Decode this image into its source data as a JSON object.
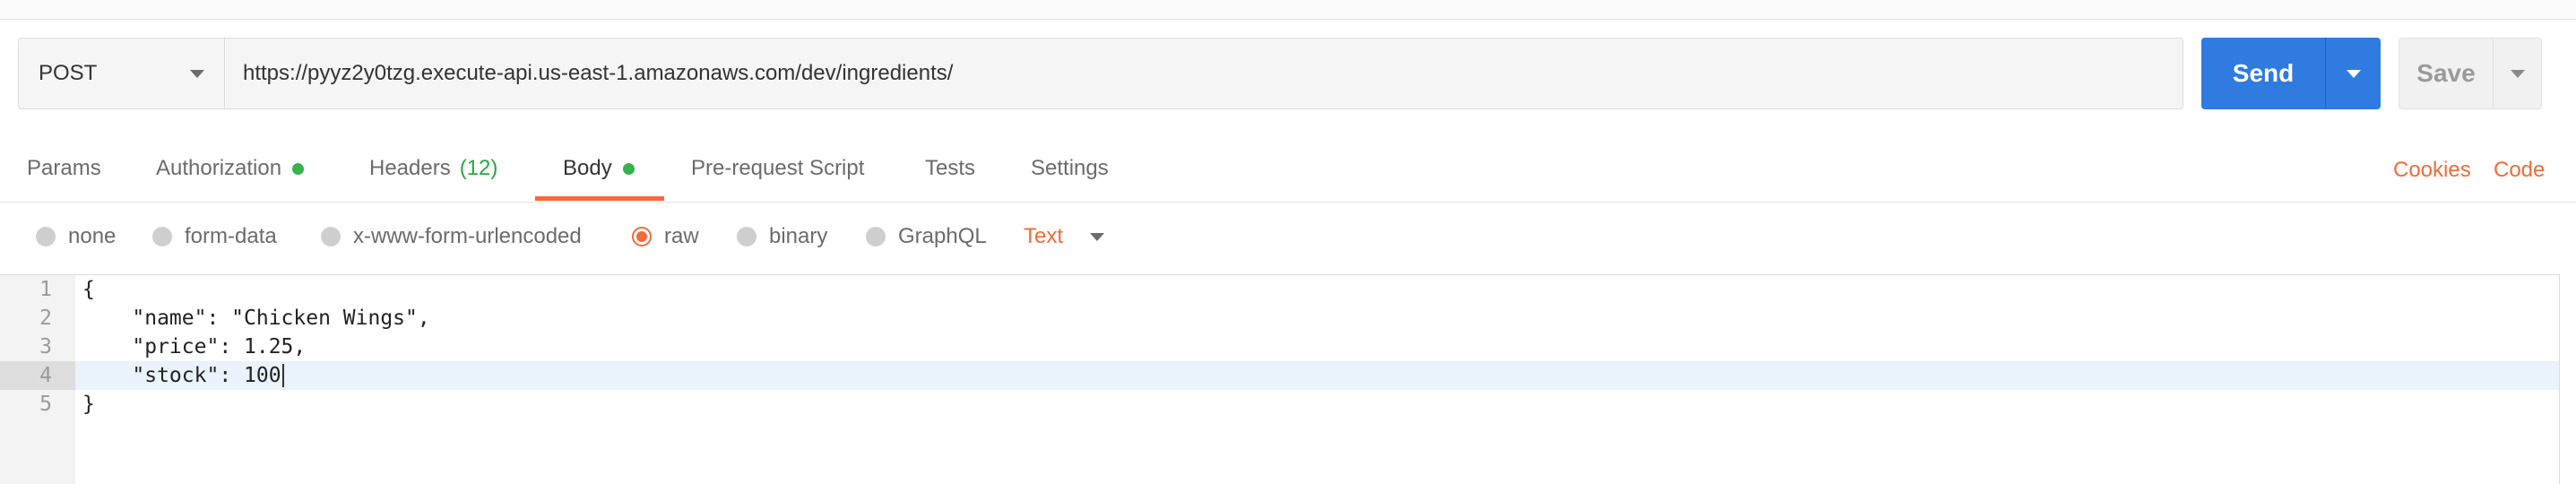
{
  "request": {
    "method": "POST",
    "url": "https://pyyz2y0tzg.execute-api.us-east-1.amazonaws.com/dev/ingredients/",
    "send_label": "Send",
    "save_label": "Save"
  },
  "tabs": [
    {
      "label": "Params"
    },
    {
      "label": "Authorization",
      "indicator": "green-dot"
    },
    {
      "label": "Headers",
      "count": "(12)"
    },
    {
      "label": "Body",
      "indicator": "green-dot",
      "active": true
    },
    {
      "label": "Pre-request Script"
    },
    {
      "label": "Tests"
    },
    {
      "label": "Settings"
    }
  ],
  "links": {
    "cookies": "Cookies",
    "code": "Code"
  },
  "body_types": {
    "options": [
      "none",
      "form-data",
      "x-www-form-urlencoded",
      "raw",
      "binary",
      "GraphQL"
    ],
    "selected": "raw",
    "content_type": "Text"
  },
  "editor": {
    "lines": [
      {
        "num": "1",
        "text": "{"
      },
      {
        "num": "2",
        "text": "    \"name\": \"Chicken Wings\","
      },
      {
        "num": "3",
        "text": "    \"price\": 1.25,"
      },
      {
        "num": "4",
        "text": "    \"stock\": 100"
      },
      {
        "num": "5",
        "text": "}"
      }
    ],
    "active_line": 4
  },
  "colors": {
    "accent": "#f26b3a",
    "send_blue": "#2f7be0",
    "indicator_green": "#37b24d",
    "count_green": "#28a745"
  }
}
